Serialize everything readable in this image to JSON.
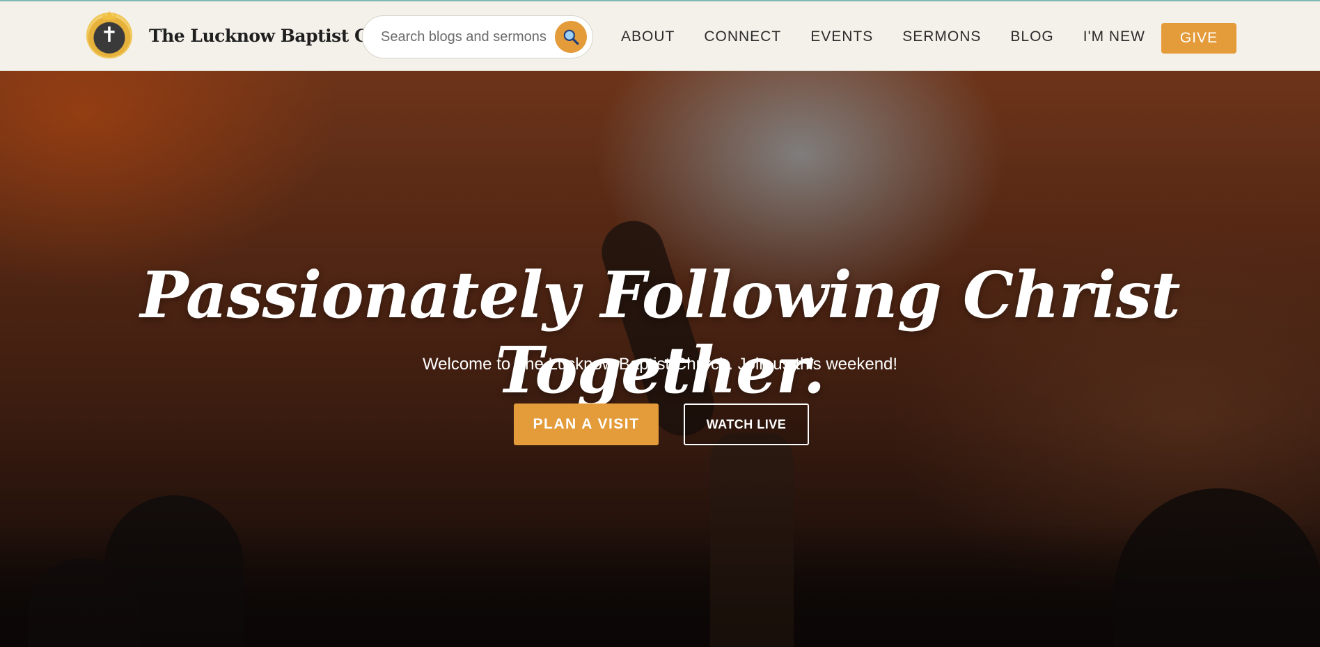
{
  "header": {
    "logo_text": "The Lucknow Baptist Church",
    "search_placeholder": "Search blogs and sermons",
    "nav": [
      "ABOUT",
      "CONNECT",
      "EVENTS",
      "SERMONS",
      "BLOG",
      "I'M NEW"
    ],
    "give_label": "GIVE"
  },
  "hero": {
    "title": "Passionately Following Christ Together.",
    "subtitle": "Welcome to The Lucknow Baptist Church. Join us this weekend!",
    "primary_button": "PLAN A VISIT",
    "secondary_button": "WATCH LIVE"
  },
  "colors": {
    "accent": "#e49b39",
    "header_bg": "#f4f1ea",
    "text_dark": "#2b2b2b"
  },
  "icons": {
    "logo": "church-crest-icon",
    "search": "search-icon"
  }
}
